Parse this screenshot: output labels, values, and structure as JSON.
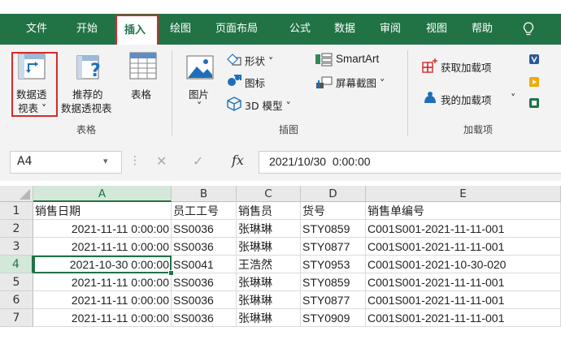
{
  "tabs": [
    "文件",
    "开始",
    "插入",
    "绘图",
    "页面布局",
    "公式",
    "数据",
    "审阅",
    "视图",
    "帮助"
  ],
  "active_tab": "插入",
  "ribbon": {
    "pivot_table": {
      "line1": "数据透",
      "line2": "视表 ˅"
    },
    "recommended_pivot": {
      "line1": "推荐的",
      "line2": "数据透视表"
    },
    "table": "表格",
    "tables_group": "表格",
    "pictures": {
      "line1": "图片",
      "line2": "˅"
    },
    "shapes": "形状 ˅",
    "icons": "图标",
    "models3d": "3D 模型 ˅",
    "smartart": "SmartArt",
    "screenshot": "屏幕截图 ˅",
    "illustrations_group": "插图",
    "get_addins": "获取加载项",
    "my_addins": "我的加载项",
    "my_addins_arrow": "˅",
    "addins_group": "加载项"
  },
  "formula_bar": {
    "name_box": "A4",
    "dropdown": "▾",
    "dots": "⋮",
    "cancel": "✕",
    "enter": "✓",
    "fx": "fx",
    "value": "2021/10/30  0:00:00"
  },
  "columns": [
    "A",
    "B",
    "C",
    "D",
    "E"
  ],
  "rows": [
    {
      "num": "1",
      "cells": [
        "销售日期",
        "员工工号",
        "销售员",
        "货号",
        "销售单编号"
      ]
    },
    {
      "num": "2",
      "cells": [
        "2021-11-11 0:00:00",
        "SS0036",
        "张琳琳",
        "STY0859",
        "C001S001-2021-11-11-001"
      ]
    },
    {
      "num": "3",
      "cells": [
        "2021-11-11 0:00:00",
        "SS0036",
        "张琳琳",
        "STY0877",
        "C001S001-2021-11-11-001"
      ]
    },
    {
      "num": "4",
      "cells": [
        "2021-10-30 0:00:00",
        "SS0041",
        "王浩然",
        "STY0953",
        "C001S001-2021-10-30-020"
      ]
    },
    {
      "num": "5",
      "cells": [
        "2021-11-11 0:00:00",
        "SS0036",
        "张琳琳",
        "STY0859",
        "C001S001-2021-11-11-001"
      ]
    },
    {
      "num": "6",
      "cells": [
        "2021-11-11 0:00:00",
        "SS0036",
        "张琳琳",
        "STY0877",
        "C001S001-2021-11-11-001"
      ]
    },
    {
      "num": "7",
      "cells": [
        "2021-11-11 0:00:00",
        "SS0036",
        "张琳琳",
        "STY0909",
        "C001S001-2021-11-11-001"
      ]
    }
  ],
  "colors": {
    "accent": "#217346",
    "highlight": "#d62a2a"
  },
  "icons": [
    "lightbulb-icon",
    "pivot-table-icon",
    "recommended-pivot-icon",
    "table-icon",
    "pictures-icon",
    "shapes-icon",
    "icons-icon",
    "3d-models-icon",
    "smartart-icon",
    "screenshot-icon",
    "get-addins-icon",
    "my-addins-icon",
    "visio-icon",
    "bing-icon",
    "people-icon"
  ]
}
